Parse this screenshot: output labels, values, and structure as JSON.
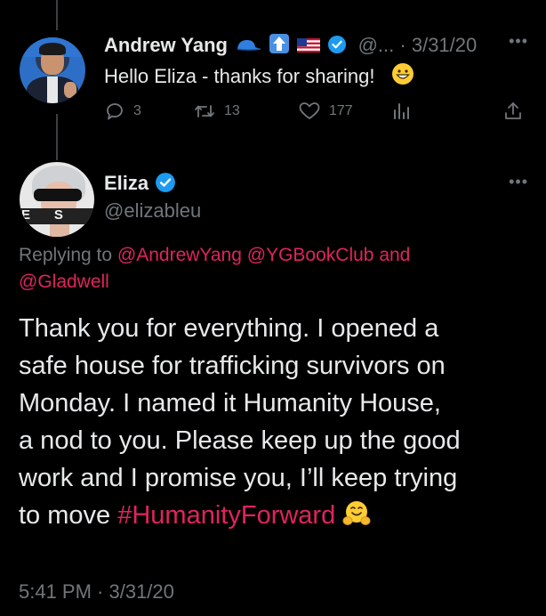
{
  "parent_tweet": {
    "author_name": "Andrew Yang",
    "name_emojis": [
      "blue-cap-icon",
      "up-arrow-icon",
      "us-flag-icon"
    ],
    "verified": true,
    "handle_truncated": "@...",
    "separator": "·",
    "date": "3/31/20",
    "text": "Hello Eliza - thanks for sharing!",
    "text_emoji": "grinning-face-icon",
    "actions": {
      "reply_count": "3",
      "retweet_count": "13",
      "like_count": "177"
    }
  },
  "main_tweet": {
    "author_name": "Eliza",
    "verified": true,
    "handle": "@elizableu",
    "avatar_banner_text": "E     S",
    "replying_prefix": "Replying to",
    "mentions": [
      "@AndrewYang",
      "@YGBookClub",
      "@Gladwell"
    ],
    "mentions_joiner": "and",
    "body_lines": [
      "Thank you for everything. I opened a",
      "safe house for trafficking survivors on",
      "Monday. I named it Humanity House,",
      "a nod to you. Please keep up the good",
      "work and I promise you, I’ll keep trying",
      "to move"
    ],
    "hashtag": "#HumanityForward",
    "body_emoji": "hugging-face-icon",
    "timestamp": "5:41 PM · 3/31/20"
  },
  "colors": {
    "background": "#000000",
    "primary_text": "#e7e9ea",
    "secondary_text": "#71767b",
    "link_accent": "#e0245e",
    "verified_blue": "#1d9bf0",
    "thread_line": "#3d4043"
  }
}
